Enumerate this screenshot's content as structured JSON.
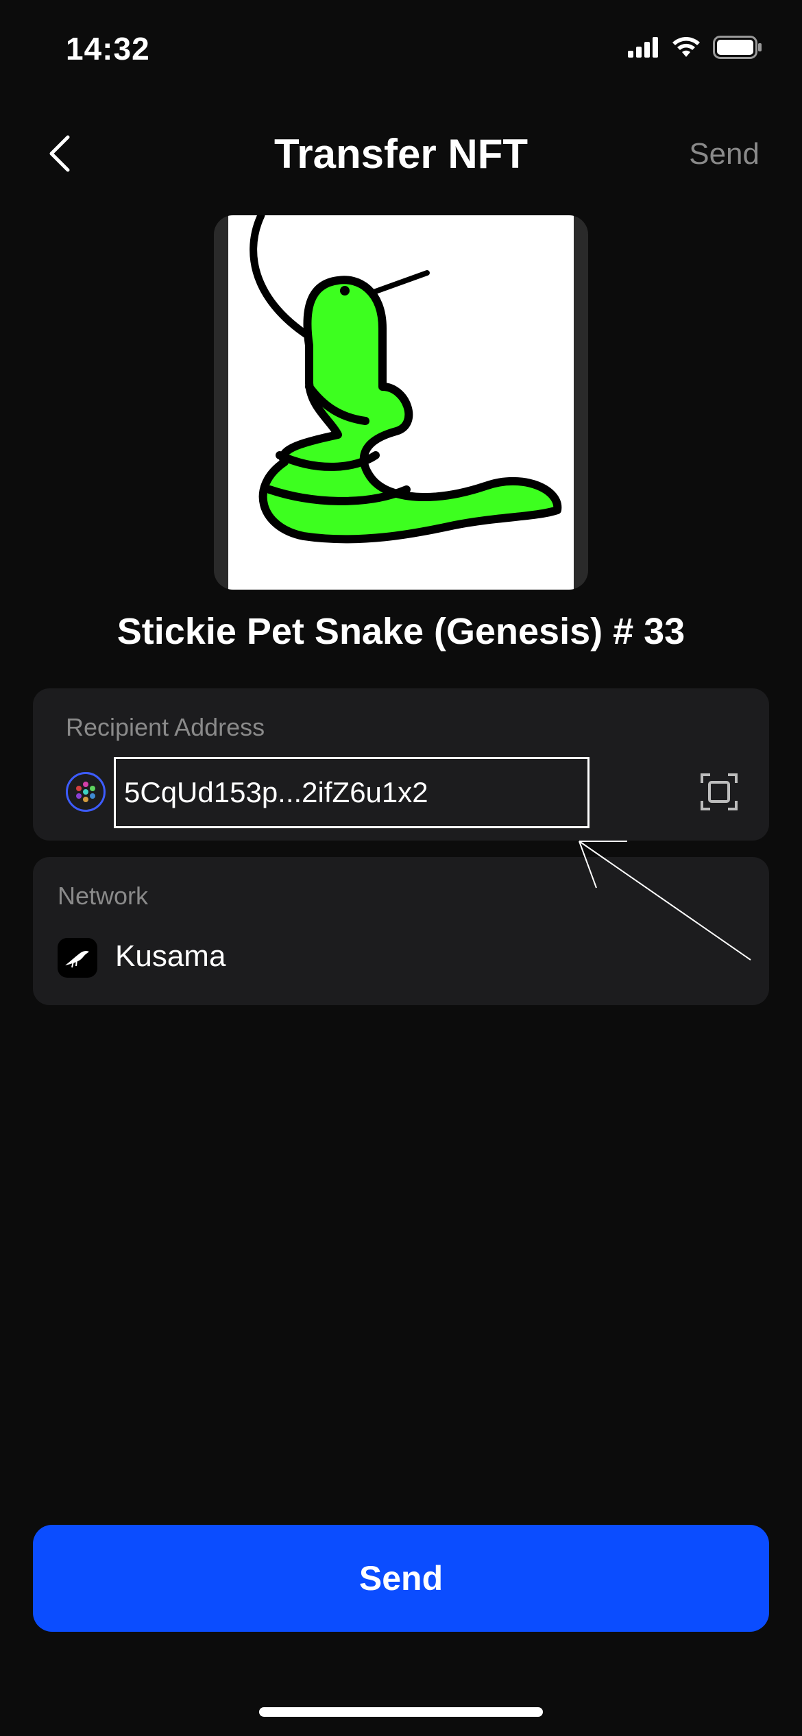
{
  "status_bar": {
    "time": "14:32",
    "icons": [
      "signal-icon",
      "wifi-icon",
      "battery-icon"
    ]
  },
  "header": {
    "back_icon": "chevron-left-icon",
    "title": "Transfer NFT",
    "send_label": "Send"
  },
  "nft": {
    "name": "Stickie Pet Snake (Genesis) # 33"
  },
  "recipient": {
    "label": "Recipient Address",
    "address": "5CqUd153p...2ifZ6u1x2",
    "scan_icon": "scan-icon"
  },
  "network": {
    "label": "Network",
    "name": "Kusama",
    "icon": "kusama-logo-icon"
  },
  "footer": {
    "send_label": "Send"
  },
  "colors": {
    "background": "#0c0c0c",
    "card": "#1c1c1e",
    "primary": "#0b4dff",
    "muted_text": "#8a8a8a",
    "snake_green": "#3dff1f"
  }
}
